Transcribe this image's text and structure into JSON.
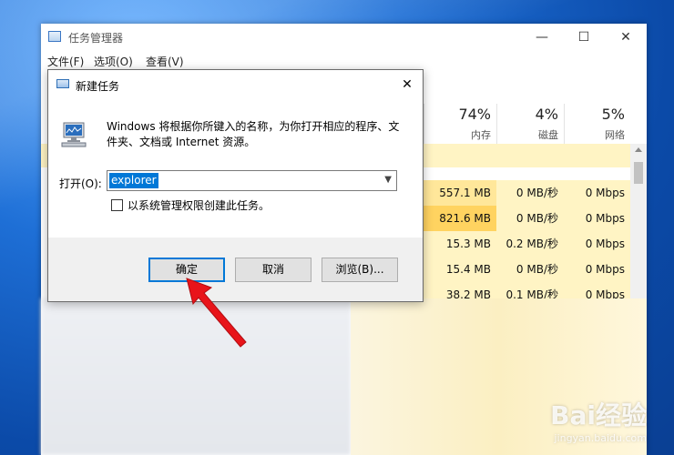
{
  "task_manager": {
    "title": "任务管理器",
    "menu": [
      "文件(F)",
      "选项(O)",
      "查看(V)"
    ],
    "columns": [
      {
        "pct": "74%",
        "label": "内存"
      },
      {
        "pct": "4%",
        "label": "磁盘"
      },
      {
        "pct": "5%",
        "label": "网络"
      }
    ],
    "rows": [
      {
        "mem": "557.1 MB",
        "disk": "0 MB/秒",
        "net": "0 Mbps"
      },
      {
        "mem": "821.6 MB",
        "disk": "0 MB/秒",
        "net": "0 Mbps"
      },
      {
        "mem": "15.3 MB",
        "disk": "0.2 MB/秒",
        "net": "0 Mbps"
      },
      {
        "mem": "15.4 MB",
        "disk": "0 MB/秒",
        "net": "0 Mbps"
      },
      {
        "mem": "38.2 MB",
        "disk": "0.1 MB/秒",
        "net": "0 Mbps"
      }
    ],
    "window_buttons": {
      "minimize": "—",
      "maximize": "☐",
      "close": "✕"
    }
  },
  "run_dialog": {
    "title": "新建任务",
    "description": "Windows 将根据你所键入的名称，为你打开相应的程序、文件夹、文档或 Internet 资源。",
    "open_label": "打开(O):",
    "input_value": "explorer",
    "checkbox_label": "以系统管理权限创建此任务。",
    "checkbox_checked": false,
    "buttons": {
      "ok": "确定",
      "cancel": "取消",
      "browse": "浏览(B)..."
    },
    "close": "✕"
  },
  "watermark": {
    "main": "Bai经验",
    "sub": "jingyan.baidu.com"
  },
  "colors": {
    "accent": "#0078d7",
    "arrow": "#e8141a"
  }
}
